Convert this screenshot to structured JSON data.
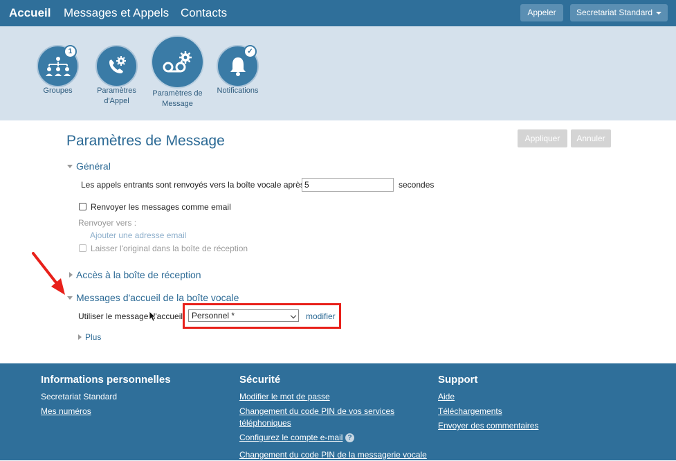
{
  "nav": {
    "home": "Accueil",
    "messages": "Messages et Appels",
    "contacts": "Contacts",
    "call_button": "Appeler",
    "account_button": "Secretariat Standard"
  },
  "icons": [
    {
      "label": "Groupes",
      "badge": "1",
      "icon": "group-icon"
    },
    {
      "label": "Paramètres d'Appel",
      "icon": "phone-gear-icon"
    },
    {
      "label": "Paramètres de Message",
      "icon": "voicemail-gear-icon"
    },
    {
      "label": "Notifications",
      "icon": "bell-icon",
      "badge": "✓"
    }
  ],
  "page": {
    "title": "Paramètres de Message",
    "apply": "Appliquer",
    "cancel": "Annuler"
  },
  "general": {
    "title": "Général",
    "forward_label": "Les appels entrants sont renvoyés vers la boîte vocale après",
    "forward_value": "5",
    "seconds": "secondes",
    "email_checkbox": "Renvoyer les messages comme email",
    "forward_to": "Renvoyer vers :",
    "add_email": "Ajouter une adresse email",
    "keep_original": "Laisser l'original dans la boîte de réception"
  },
  "inbox_access": {
    "title": "Accès à la boîte de réception"
  },
  "greetings": {
    "title": "Messages d'accueil de la boîte vocale",
    "use_label": "Utiliser le message d'accueil",
    "selected": "Personnel *",
    "modify": "modifier",
    "more": "Plus"
  },
  "footer": {
    "personal": {
      "title": "Informations personnelles",
      "name": "Secretariat Standard",
      "numbers": "Mes numéros"
    },
    "security": {
      "title": "Sécurité",
      "change_password": "Modifier le mot de passe",
      "change_pin_services": "Changement du code PIN de vos services téléphoniques",
      "configure_email": "Configurez le compte e-mail",
      "change_pin_voicemail": "Changement du code PIN de la messagerie vocale"
    },
    "support": {
      "title": "Support",
      "help": "Aide",
      "downloads": "Téléchargements",
      "feedback": "Envoyer des commentaires"
    }
  },
  "colors": {
    "header": "#2f6f9a",
    "band": "#d5e1ec",
    "accent": "#2c6a95",
    "annotation": "#e8201a"
  }
}
